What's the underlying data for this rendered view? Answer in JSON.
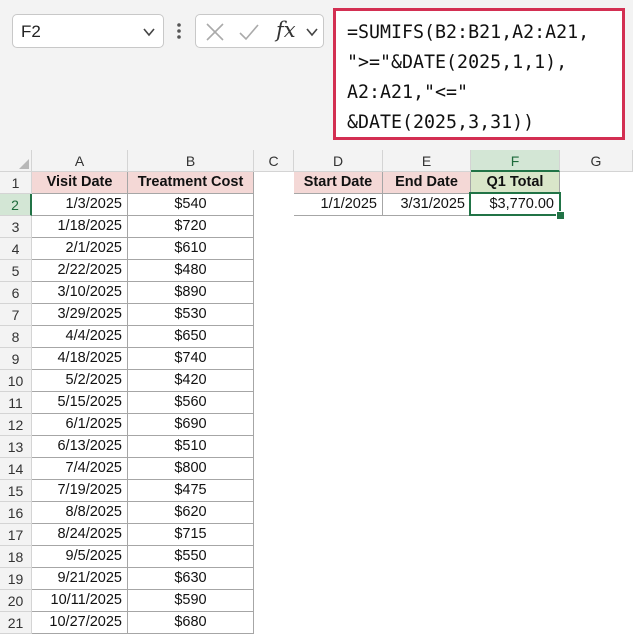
{
  "name_box": {
    "value": "F2",
    "dropdown_icon": "chevron-down-icon"
  },
  "formula_bar": {
    "cancel_icon": "close-icon",
    "enter_icon": "check-icon",
    "fx_label": "fx",
    "dropdown_icon": "chevron-down-icon",
    "formula_lines": [
      "=SUMIFS(B2:B21,A2:A21,",
      "\">=\"&DATE(2025,1,1),",
      "A2:A21,\"<=\"",
      "&DATE(2025,3,31))"
    ]
  },
  "colors": {
    "highlight_border": "#d32f52",
    "selection": "#217346",
    "header_fill_pink": "#f4d8d6",
    "header_fill_green": "#d9e6c9"
  },
  "sheet": {
    "columns": [
      "A",
      "B",
      "C",
      "D",
      "E",
      "F",
      "G"
    ],
    "selected_column": "F",
    "selected_row": 2,
    "table1": {
      "headers": [
        "Visit Date",
        "Treatment Cost"
      ],
      "rows": [
        [
          "1/3/2025",
          "$540"
        ],
        [
          "1/18/2025",
          "$720"
        ],
        [
          "2/1/2025",
          "$610"
        ],
        [
          "2/22/2025",
          "$480"
        ],
        [
          "3/10/2025",
          "$890"
        ],
        [
          "3/29/2025",
          "$530"
        ],
        [
          "4/4/2025",
          "$650"
        ],
        [
          "4/18/2025",
          "$740"
        ],
        [
          "5/2/2025",
          "$420"
        ],
        [
          "5/15/2025",
          "$560"
        ],
        [
          "6/1/2025",
          "$690"
        ],
        [
          "6/13/2025",
          "$510"
        ],
        [
          "7/4/2025",
          "$800"
        ],
        [
          "7/19/2025",
          "$475"
        ],
        [
          "8/8/2025",
          "$620"
        ],
        [
          "8/24/2025",
          "$715"
        ],
        [
          "9/5/2025",
          "$550"
        ],
        [
          "9/21/2025",
          "$630"
        ],
        [
          "10/11/2025",
          "$590"
        ],
        [
          "10/27/2025",
          "$680"
        ]
      ]
    },
    "table2": {
      "headers": [
        "Start Date",
        "End Date",
        "Q1 Total"
      ],
      "row": [
        "1/1/2025",
        "3/31/2025",
        "$3,770.00"
      ]
    }
  }
}
